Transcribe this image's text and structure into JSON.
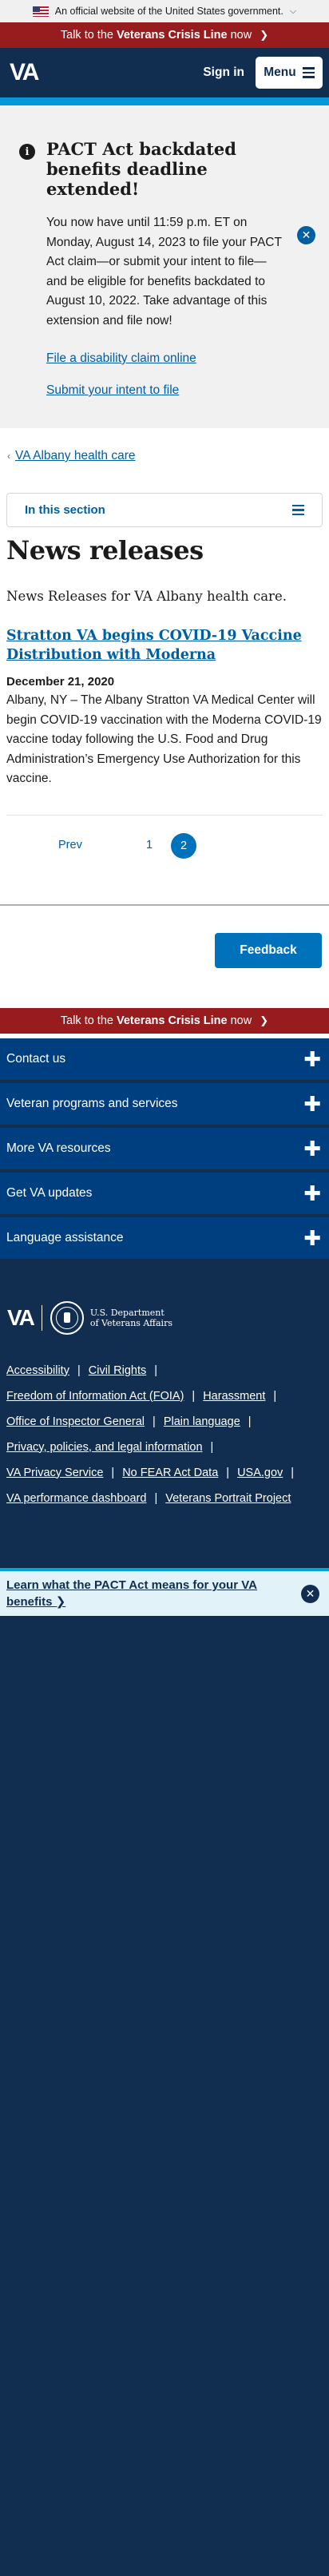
{
  "official_banner": {
    "text": "An official website of the United States government."
  },
  "crisis_line": {
    "prefix": "Talk to the ",
    "emphasis": "Veterans Crisis Line",
    "suffix": " now"
  },
  "header": {
    "logo": "VA",
    "sign_in": "Sign in",
    "menu": "Menu"
  },
  "alert": {
    "title": "PACT Act backdated benefits deadline extended!",
    "body": "You now have until 11:59 p.m. ET on Monday, August 14, 2023 to file your PACT Act claim—or submit your intent to file—and be eligible for benefits backdated to August 10, 2022. Take advantage of this extension and file now!",
    "link1": "File a disability claim online",
    "link2": "Submit your intent to file"
  },
  "breadcrumb": {
    "label": "VA Albany health care"
  },
  "section_nav": {
    "label": "In this section"
  },
  "page": {
    "title": "News releases",
    "intro": "News Releases for VA Albany health care."
  },
  "news": {
    "title": "Stratton VA begins COVID-19 Vaccine Distribution with Moderna",
    "date": "December 21, 2020",
    "summary": "Albany, NY – The Albany Stratton VA Medical Center will begin COVID-19 vaccination with the Moderna COVID-19 vaccine today following the U.S. Food and Drug Administration’s Emergency Use Authorization for this vaccine."
  },
  "pagination": {
    "prev": "Prev",
    "page1": "1",
    "page2": "2"
  },
  "feedback": {
    "label": "Feedback"
  },
  "footer": {
    "accordions": [
      "Contact us",
      "Veteran programs and services",
      "More VA resources",
      "Get VA updates",
      "Language assistance"
    ],
    "logo": "VA",
    "dept_line1": "U.S. Department",
    "dept_line2": "of Veterans Affairs",
    "links": {
      "accessibility": "Accessibility",
      "civil_rights": "Civil Rights",
      "foia": "Freedom of Information Act (FOIA)",
      "harassment": "Harassment",
      "oig": "Office of Inspector General",
      "plain_language": "Plain language",
      "privacy": "Privacy, policies, and legal information",
      "privacy_service": "VA Privacy Service",
      "no_fear": "No FEAR Act Data",
      "usa_gov": "USA.gov",
      "dashboard": "VA performance dashboard",
      "portrait": "Veterans Portrait Project"
    }
  },
  "pact_banner": {
    "text": "Learn what the PACT Act means for your VA benefits"
  },
  "icons": {
    "flag": "us-flag-icon",
    "chevron": "chevron-down-icon",
    "info": "info-icon",
    "close": "close-icon",
    "plus": "plus-icon",
    "hamburger": "hamburger-icon"
  },
  "colors": {
    "primary": "#005ea2",
    "header_bg": "#112e51",
    "crisis_red": "#981b1e",
    "accordion_bg": "#003f7f",
    "accent_cyan": "#0099d8"
  }
}
